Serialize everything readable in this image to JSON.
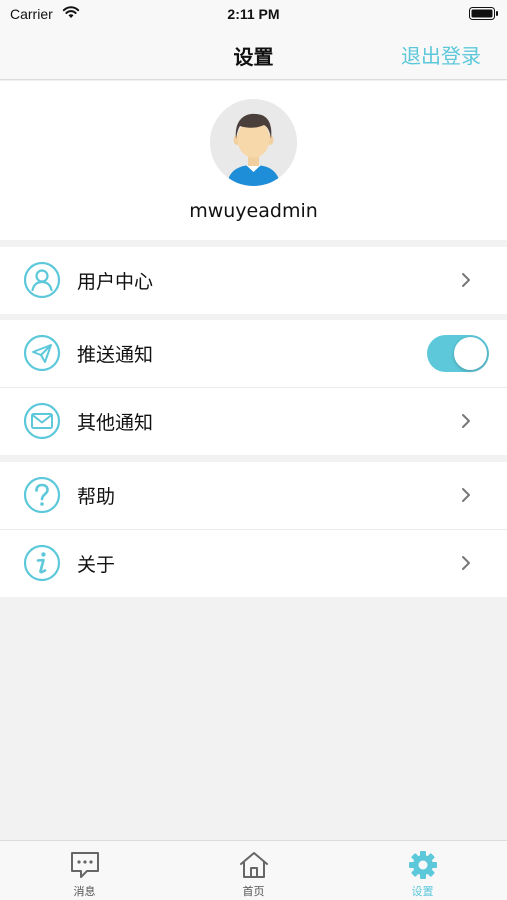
{
  "status_bar": {
    "carrier": "Carrier",
    "time": "2:11 PM"
  },
  "nav": {
    "title": "设置",
    "logout_label": "退出登录"
  },
  "profile": {
    "username": "mwuyeadmin"
  },
  "settings": {
    "items": [
      {
        "label": "用户中心",
        "icon": "user-circle-icon",
        "control": "chevron"
      },
      {
        "label": "推送通知",
        "icon": "paper-plane-icon",
        "control": "toggle",
        "enabled": true
      },
      {
        "label": "其他通知",
        "icon": "envelope-icon",
        "control": "chevron"
      },
      {
        "label": "帮助",
        "icon": "question-icon",
        "control": "chevron"
      },
      {
        "label": "关于",
        "icon": "info-icon",
        "control": "chevron"
      }
    ]
  },
  "tab_bar": {
    "tabs": [
      {
        "label": "消息",
        "icon": "message-icon",
        "active": false
      },
      {
        "label": "首页",
        "icon": "home-icon",
        "active": false
      },
      {
        "label": "设置",
        "icon": "gear-icon",
        "active": true
      }
    ]
  },
  "colors": {
    "accent": "#5cc8da",
    "background": "#f2f2f2",
    "text": "#111111"
  }
}
